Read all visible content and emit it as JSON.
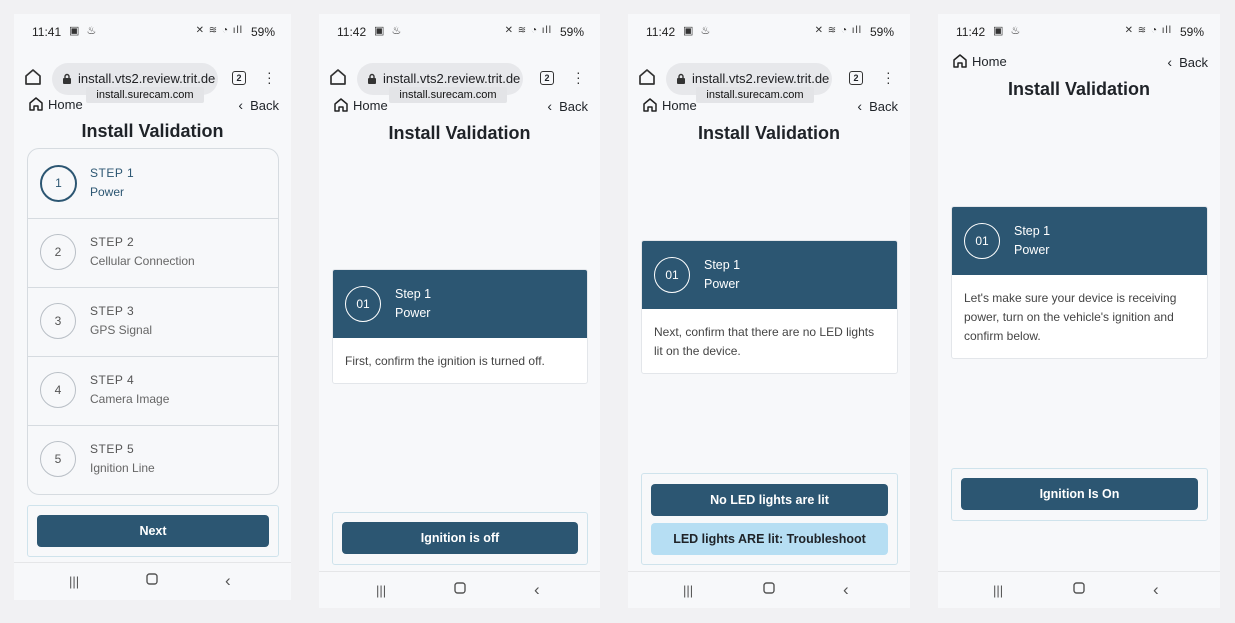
{
  "screens": [
    {
      "status": {
        "time": "11:41",
        "battery": "59%"
      },
      "browser": {
        "url": "install.vts2.review.trit.de",
        "tab_count": "2",
        "tooltip": "install.surecam.com"
      },
      "nav": {
        "home": "Home",
        "back": "Back"
      },
      "title": "Install Validation",
      "steps": [
        {
          "num": "1",
          "title": "STEP 1",
          "subtitle": "Power"
        },
        {
          "num": "2",
          "title": "STEP 2",
          "subtitle": "Cellular Connection"
        },
        {
          "num": "3",
          "title": "STEP 3",
          "subtitle": "GPS Signal"
        },
        {
          "num": "4",
          "title": "STEP 4",
          "subtitle": "Camera Image"
        },
        {
          "num": "5",
          "title": "STEP 5",
          "subtitle": "Ignition Line"
        }
      ],
      "next_button": "Next"
    },
    {
      "status": {
        "time": "11:42",
        "battery": "59%"
      },
      "browser": {
        "url": "install.vts2.review.trit.de",
        "tab_count": "2",
        "tooltip": "install.surecam.com"
      },
      "nav": {
        "home": "Home",
        "back": "Back"
      },
      "title": "Install Validation",
      "card": {
        "num": "01",
        "step": "Step 1",
        "name": "Power",
        "body": "First, confirm the ignition is turned off."
      },
      "button": "Ignition is off"
    },
    {
      "status": {
        "time": "11:42",
        "battery": "59%"
      },
      "browser": {
        "url": "install.vts2.review.trit.de",
        "tab_count": "2",
        "tooltip": "install.surecam.com"
      },
      "nav": {
        "home": "Home",
        "back": "Back"
      },
      "title": "Install Validation",
      "card": {
        "num": "01",
        "step": "Step 1",
        "name": "Power",
        "body": "Next, confirm that there are no LED lights lit on the device."
      },
      "button_primary": "No LED lights are lit",
      "button_secondary": "LED lights ARE lit: Troubleshoot"
    },
    {
      "status": {
        "time": "11:42",
        "battery": "59%"
      },
      "nav": {
        "home": "Home",
        "back": "Back"
      },
      "title": "Install Validation",
      "card": {
        "num": "01",
        "step": "Step 1",
        "name": "Power",
        "body": "Let's make sure your device is receiving power, turn on the vehicle's ignition and confirm below."
      },
      "button": "Ignition Is On"
    }
  ],
  "colors": {
    "primary": "#2c5672",
    "secondary": "#b6def3",
    "background": "#f7f8fa"
  },
  "icons": {
    "home": "home-icon",
    "back": "chevron-left-icon",
    "lock": "lock-icon",
    "menu": "kebab-menu-icon",
    "recents": "recents-icon",
    "home_nav": "home-nav-icon",
    "back_nav": "back-nav-icon"
  }
}
